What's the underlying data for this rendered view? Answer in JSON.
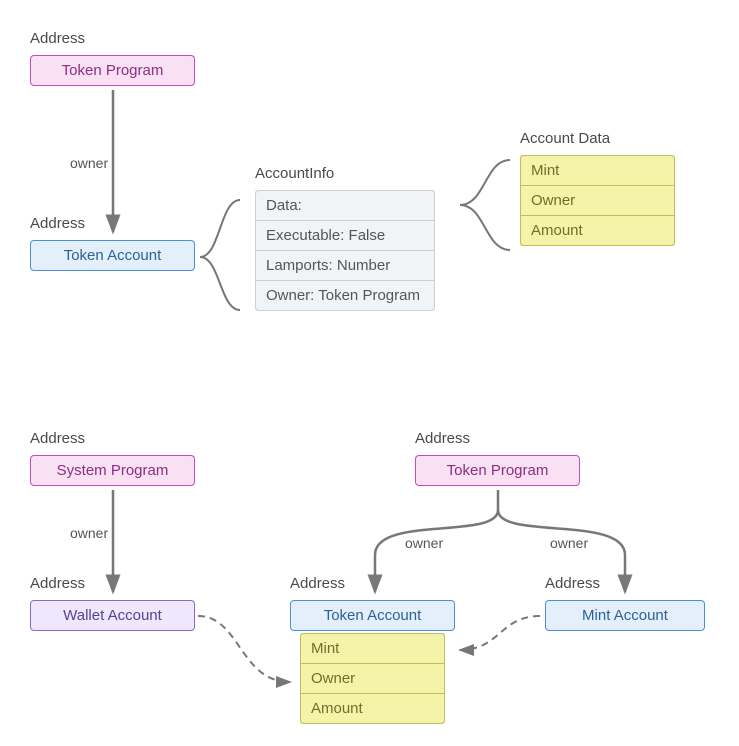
{
  "top": {
    "address_label": "Address",
    "token_program": "Token Program",
    "token_account": "Token Account",
    "owner_edge": "owner",
    "account_info": {
      "title": "AccountInfo",
      "rows": [
        "Data:",
        "Executable: False",
        "Lamports: Number",
        "Owner: Token Program"
      ]
    },
    "account_data": {
      "title": "Account Data",
      "rows": [
        "Mint",
        "Owner",
        "Amount"
      ]
    }
  },
  "bottom": {
    "address_label": "Address",
    "system_program": "System Program",
    "token_program": "Token Program",
    "wallet_account": "Wallet Account",
    "token_account": "Token Account",
    "mint_account": "Mint Account",
    "owner_edge": "owner",
    "token_account_fields": [
      "Mint",
      "Owner",
      "Amount"
    ]
  }
}
